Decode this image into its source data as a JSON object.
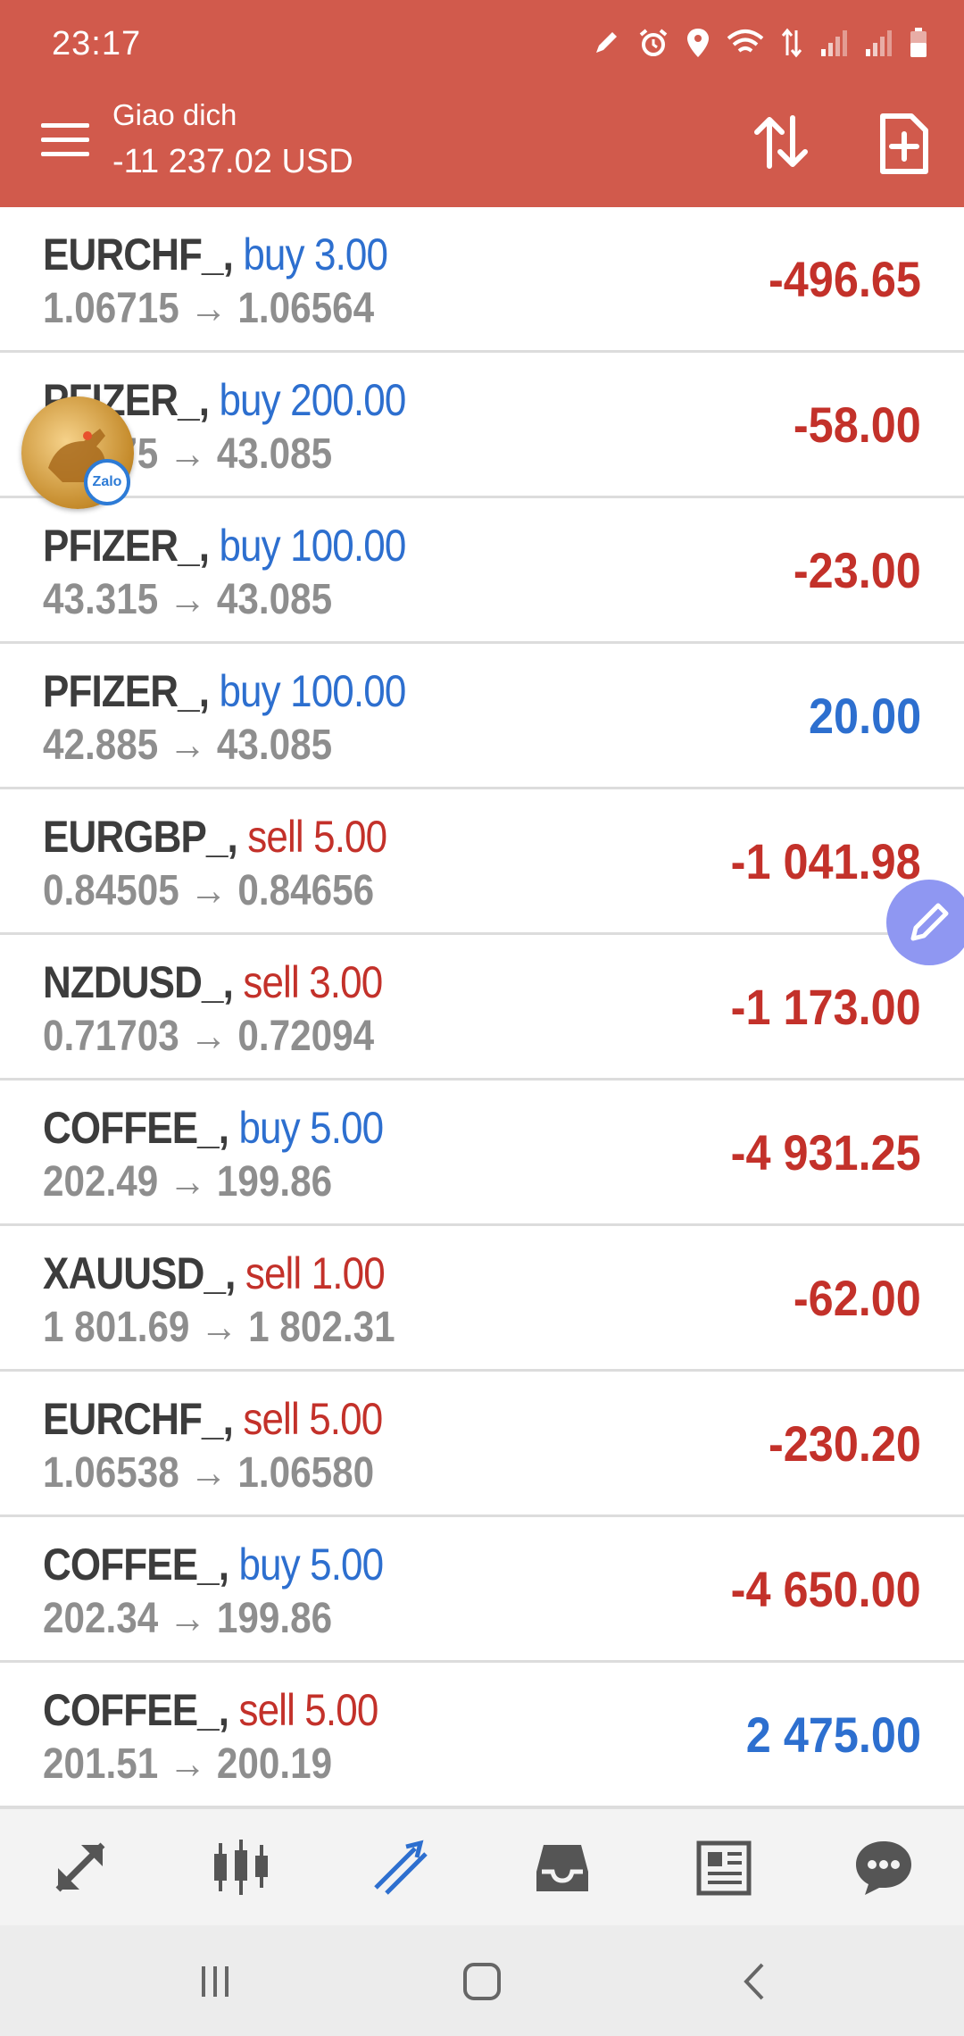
{
  "status_bar": {
    "time": "23:17",
    "icons": [
      "pen-icon",
      "alarm-icon",
      "location-icon",
      "wifi-icon",
      "data-arrows-icon",
      "signal-icon",
      "signal-icon",
      "battery-icon"
    ]
  },
  "header": {
    "title": "Giao dich",
    "balance": "-11 237.02 USD",
    "sort_icon": "sort-icon",
    "new_order_icon": "new-order-icon"
  },
  "colors": {
    "header_bg": "#d15a4c",
    "buy": "#2d6fcf",
    "sell": "#c3312a",
    "symbol": "#3c3c3c",
    "price": "#8e8e8e"
  },
  "positions": [
    {
      "symbol": "EURCHF_,",
      "side": "buy",
      "volume": "buy 3.00",
      "prices": "1.06715 → 1.06564",
      "profit": "-496.65",
      "sign": "neg"
    },
    {
      "symbol": "PFIZER_,",
      "side": "buy",
      "volume": "buy 200.00",
      "prices": "43.375 → 43.085",
      "profit": "-58.00",
      "sign": "neg"
    },
    {
      "symbol": "PFIZER_,",
      "side": "buy",
      "volume": "buy 100.00",
      "prices": "43.315 → 43.085",
      "profit": "-23.00",
      "sign": "neg"
    },
    {
      "symbol": "PFIZER_,",
      "side": "buy",
      "volume": "buy 100.00",
      "prices": "42.885 → 43.085",
      "profit": "20.00",
      "sign": "pos"
    },
    {
      "symbol": "EURGBP_,",
      "side": "sell",
      "volume": "sell 5.00",
      "prices": "0.84505 → 0.84656",
      "profit": "-1 041.98",
      "sign": "neg"
    },
    {
      "symbol": "NZDUSD_,",
      "side": "sell",
      "volume": "sell 3.00",
      "prices": "0.71703 → 0.72094",
      "profit": "-1 173.00",
      "sign": "neg"
    },
    {
      "symbol": "COFFEE_,",
      "side": "buy",
      "volume": "buy 5.00",
      "prices": "202.49 → 199.86",
      "profit": "-4 931.25",
      "sign": "neg"
    },
    {
      "symbol": "XAUUSD_,",
      "side": "sell",
      "volume": "sell 1.00",
      "prices": "1 801.69 → 1 802.31",
      "profit": "-62.00",
      "sign": "neg"
    },
    {
      "symbol": "EURCHF_,",
      "side": "sell",
      "volume": "sell 5.00",
      "prices": "1.06538 → 1.06580",
      "profit": "-230.20",
      "sign": "neg"
    },
    {
      "symbol": "COFFEE_,",
      "side": "buy",
      "volume": "buy 5.00",
      "prices": "202.34 → 199.86",
      "profit": "-4 650.00",
      "sign": "neg"
    },
    {
      "symbol": "COFFEE_,",
      "side": "sell",
      "volume": "sell 5.00",
      "prices": "201.51 → 200.19",
      "profit": "2 475.00",
      "sign": "pos"
    }
  ],
  "floating": {
    "zalo_label": "Zalo",
    "edit_icon": "edit-icon"
  },
  "bottom_nav": [
    {
      "name": "quotes",
      "icon": "arrows-diagonal-icon",
      "active": false
    },
    {
      "name": "chart",
      "icon": "candlestick-icon",
      "active": false
    },
    {
      "name": "trade",
      "icon": "trade-chart-icon",
      "active": true
    },
    {
      "name": "history",
      "icon": "inbox-icon",
      "active": false
    },
    {
      "name": "news",
      "icon": "newspaper-icon",
      "active": false
    },
    {
      "name": "chat",
      "icon": "chat-icon",
      "active": false
    }
  ],
  "system_nav": [
    "recents-icon",
    "home-icon",
    "back-icon"
  ]
}
